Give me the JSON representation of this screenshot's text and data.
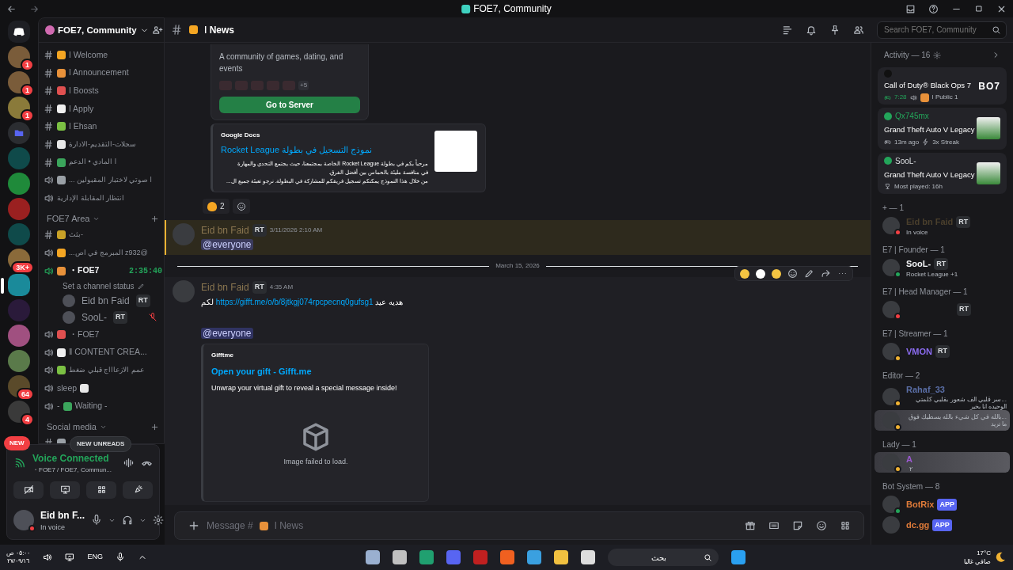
{
  "window": {
    "title": "FOE7, Community"
  },
  "server_rail": [
    {
      "badge": "1",
      "selected": false
    },
    {
      "badge": "1",
      "selected": false
    },
    {
      "badge": "1",
      "selected": false
    },
    {
      "kind": "folder",
      "selected": false
    },
    {
      "selected": false
    },
    {
      "selected": false
    },
    {
      "selected": false
    },
    {
      "selected": false
    },
    {
      "badge": "3K+",
      "selected": false
    },
    {
      "selected": true
    },
    {
      "selected": false
    },
    {
      "selected": false
    },
    {
      "selected": false
    },
    {
      "badge": "64",
      "selected": false
    },
    {
      "badge": "4",
      "selected": false
    }
  ],
  "new_badge": "NEW",
  "sidebar": {
    "server_name": "FOE7, Community",
    "channels": [
      {
        "kind": "text",
        "name": "ǀ Welcome"
      },
      {
        "kind": "text",
        "name": "ǀ Announcement"
      },
      {
        "kind": "text",
        "name": "ǀ Boosts"
      },
      {
        "kind": "text",
        "name": "ǀ Apply"
      },
      {
        "kind": "text",
        "name": "ǀ Ehsan"
      },
      {
        "kind": "text",
        "name": "سجلات-التقديم-الادارة"
      },
      {
        "kind": "text",
        "name": "ǀ المادي • الدعم"
      },
      {
        "kind": "voice",
        "name": "ǀ صوتي لاختبار المقبولين ..."
      },
      {
        "kind": "voice",
        "name": "انتظار المقابلة الإدارية",
        "no_emoji": true
      }
    ],
    "categories": [
      {
        "name": "FOE7 Area",
        "channels": [
          {
            "kind": "text",
            "name": "-بثث"
          },
          {
            "kind": "voice",
            "name": "@z932 المبرمج في اص..."
          },
          {
            "kind": "voice",
            "name": "・FOE7",
            "active": true,
            "timer": "2:35:40",
            "status": "Set a channel status",
            "members": [
              {
                "name": "Eid bn Faid",
                "tag": "RT",
                "muted": false
              },
              {
                "name": "SooL-",
                "tag": "RT",
                "muted": true
              }
            ]
          },
          {
            "kind": "voice",
            "name": "・FOE7"
          },
          {
            "kind": "voice",
            "name": "ǁ CONTENT CREA..."
          },
          {
            "kind": "voice",
            "name": "عمم الازعاااج قبلي ضغط"
          },
          {
            "kind": "voice",
            "name": "sleep",
            "emoji_after": true
          },
          {
            "kind": "voice",
            "prefix": "-",
            "name": "Waiting -"
          }
        ]
      },
      {
        "name": "Social media",
        "channels": [
          {
            "kind": "text"
          }
        ]
      }
    ],
    "new_unreads": "NEW UNREADS"
  },
  "voice_panel": {
    "title": "Voice Connected",
    "location": "・FOE7 / FOE7, Commun..."
  },
  "user_panel": {
    "name": "Eid bn F...",
    "status": "In voice"
  },
  "chat": {
    "channel": "ǀ News",
    "search": {
      "placeholder": "Search FOE7, Community"
    },
    "server_embed": {
      "description": "A community of games, dating, and events",
      "more": "+5",
      "button": "Go to Server"
    },
    "docs_embed": {
      "provider": "Google Docs",
      "title": "نموذج التسجيل في بطولة Rocket League",
      "description": [
        "مرحباً بكم في بطولة Rocket League الخاصة بمجتمعنا، حيث يجتمع التحدي والمهارة",
        "في منافسة مليئة بالحماس بين أفضل الفرق.",
        "من خلال هذا النموذج يمكنكم تسجيل فريقكم للمشاركة في البطولة. نرجو تعبئة جميع ال..."
      ]
    },
    "reactions": [
      {
        "count": "2"
      }
    ],
    "messages": [
      {
        "kind": "mention",
        "author": "Eid bn Faid",
        "tag": "RT",
        "time": "3/11/2026 2:10 AM",
        "mention": "@everyone",
        "mentioned": true,
        "hovered": false
      },
      {
        "kind": "divider",
        "text": "March 15, 2026"
      },
      {
        "kind": "gift",
        "author": "Eid bn Faid",
        "tag": "RT",
        "time": "4:35 AM",
        "text_before": "هديه عيد",
        "link": "https://gifft.me/o/b/8jtkgj074rpcpecnq0gufsg1",
        "text_after": "لكم",
        "mention": "@everyone",
        "mentioned": false,
        "hovered": true,
        "embed": {
          "provider": "Gifftme",
          "title": "Open your gift - Gifft.me",
          "description": "Unwrap your virtual gift to reveal a special message inside!",
          "image_error": "Image failed to load."
        }
      }
    ],
    "composer": {
      "placeholder": "Message #",
      "channel": "ǀ News"
    }
  },
  "members": {
    "activity": {
      "title": "Activity — 16",
      "cards": [
        {
          "title": "Call of Duty® Black Ops 7",
          "detail": "7:28",
          "extra": "ǀ Public 1",
          "logo": "BO7",
          "kind": "voice"
        },
        {
          "user": "Qx745mx",
          "title": "Grand Theft Auto V Legacy",
          "detail": "13m ago",
          "extra": "3x Streak",
          "kind": "streak"
        },
        {
          "user": "SooL-",
          "title": "Grand Theft Auto V Legacy",
          "detail": "Most played: 16h",
          "kind": "trophy"
        }
      ]
    },
    "groups": [
      {
        "name": "+ — 1",
        "members": [
          {
            "name": "Eid bn Faid",
            "color": "#4a3f2c",
            "tag": "RT",
            "status_text": "In voice",
            "status_dot": {
              "color": "#f23f43"
            },
            "banner": false
          }
        ]
      },
      {
        "name": "E7 | Founder — 1",
        "members": [
          {
            "name": "SooL-",
            "color": "#f2f3f5",
            "tag": "RT",
            "status_text": "Rocket League +1",
            "status_dot": {
              "color": "#23a55a"
            },
            "banner": false
          }
        ]
      },
      {
        "name": "E7 | Head Manager — 1",
        "members": [
          {
            "tag": "RT",
            "status_dot": {
              "color": "#f23f43"
            },
            "banner": false
          }
        ]
      },
      {
        "name": "E7 | Streamer — 1",
        "members": [
          {
            "name": "VMON",
            "color": "#8b6cf0",
            "tag": "RT",
            "status_dot": {
              "color": "#f0b232"
            },
            "banner": false
          }
        ]
      },
      {
        "name": "Editor — 2",
        "members": [
          {
            "name": "Rahaf_33",
            "color": "#5a6ea6",
            "status_text": "...سر قلبي الف شعور بقلبي كلمتي الوحيده انا بخير",
            "status_dot": {
              "color": "#f0b232"
            },
            "banner": false
          },
          {
            "status_text": "...بالله في كل شيء بالله يسطيك فوق ما تريد",
            "status_dot": {
              "color": "#f0b232"
            },
            "banner": true
          }
        ]
      },
      {
        "name": "Lady — 1",
        "members": [
          {
            "name": "A",
            "color": "#9b59d0",
            "status_text": "٢",
            "status_dot": {
              "color": "#f0b232"
            },
            "banner": true
          }
        ]
      },
      {
        "name": "Bot System — 8",
        "members": [
          {
            "name": "BotRix",
            "color": "#e07b39",
            "app": "APP",
            "status_dot": {
              "color": "#23a55a"
            },
            "banner": false
          },
          {
            "name": "dc.gg",
            "color": "#e07b39",
            "app": "APP",
            "banner": false
          }
        ]
      }
    ]
  },
  "taskbar": {
    "time": "٠٥:٠٠ ص",
    "date": "٢٧/٠٩/١٦",
    "language": "ENG",
    "search": "بحث",
    "temperature": "17°C",
    "weather": "صافي غالبا"
  }
}
